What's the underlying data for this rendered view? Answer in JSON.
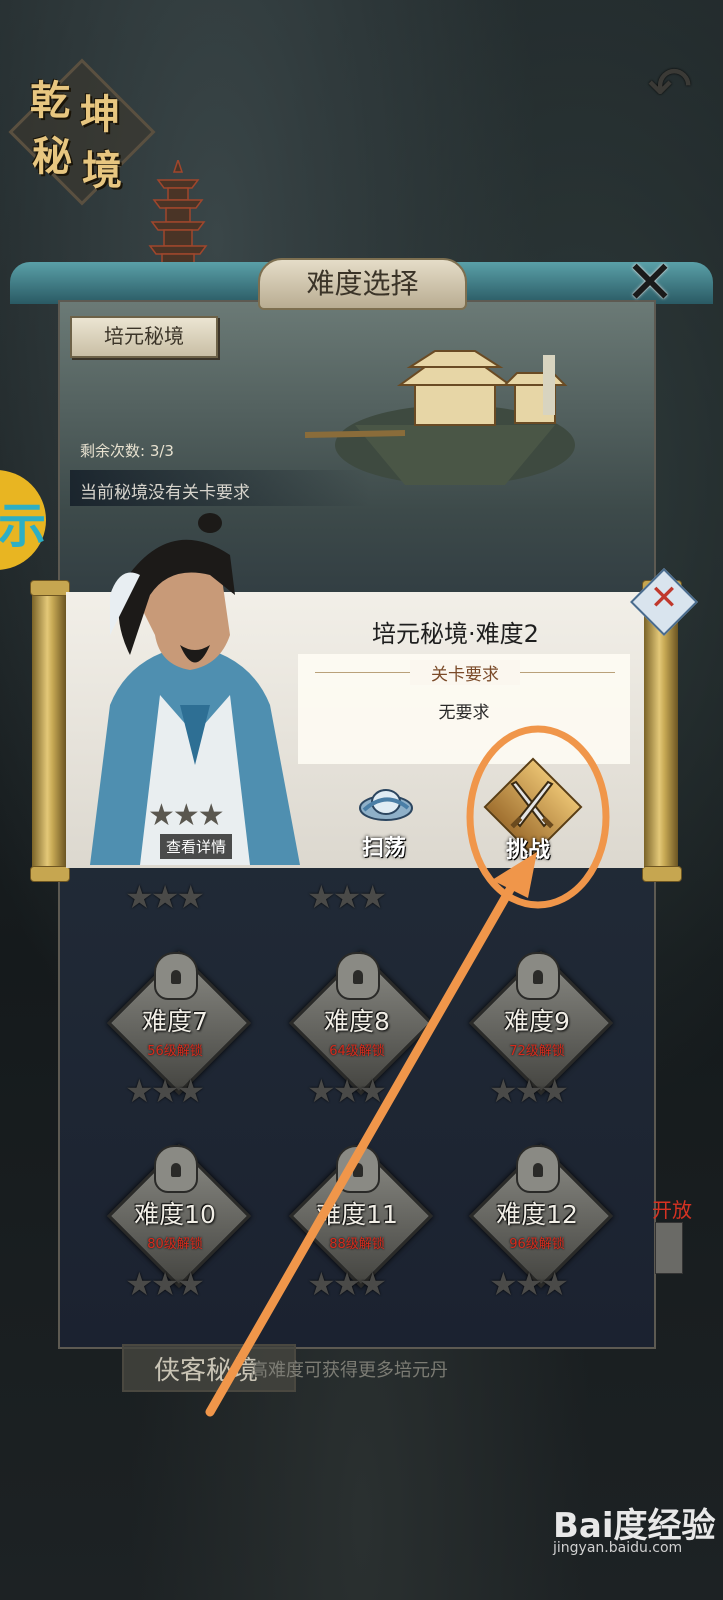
{
  "header": {
    "seal_chars": [
      "乾",
      "坤",
      "秘",
      "境"
    ],
    "back_icon": "back-arrow-icon"
  },
  "dialog": {
    "title": "难度选择",
    "close_icon": "close-x-icon",
    "dungeon_tag": "培元秘境",
    "remaining_label": "剩余次数: 3/3",
    "requirement_note": "当前秘境没有关卡要求"
  },
  "popup": {
    "title": "培元秘境·难度2",
    "requirement_header": "关卡要求",
    "requirement_value": "无要求",
    "stars_shown": 3,
    "detail_label": "查看详情",
    "sweep_label": "扫荡",
    "challenge_label": "挑战",
    "close_icon": "close-x-icon"
  },
  "levels": [
    {
      "name": "难度7",
      "unlock": "56级解锁"
    },
    {
      "name": "难度8",
      "unlock": "64级解锁"
    },
    {
      "name": "难度9",
      "unlock": "72级解锁"
    },
    {
      "name": "难度10",
      "unlock": "80级解锁"
    },
    {
      "name": "难度11",
      "unlock": "88级解锁"
    },
    {
      "name": "难度12",
      "unlock": "96级解锁"
    }
  ],
  "side_text": "开放",
  "bottom": {
    "tab_label": "侠客秘境",
    "hint": "高难度可获得更多培元丹"
  },
  "watermark": {
    "brand": "Bai度经验",
    "url": "jingyan.baidu.com"
  },
  "colors": {
    "accent_gold": "#e7c680",
    "arrow_orange": "#f0964a",
    "unlock_red": "#d62a1c"
  }
}
